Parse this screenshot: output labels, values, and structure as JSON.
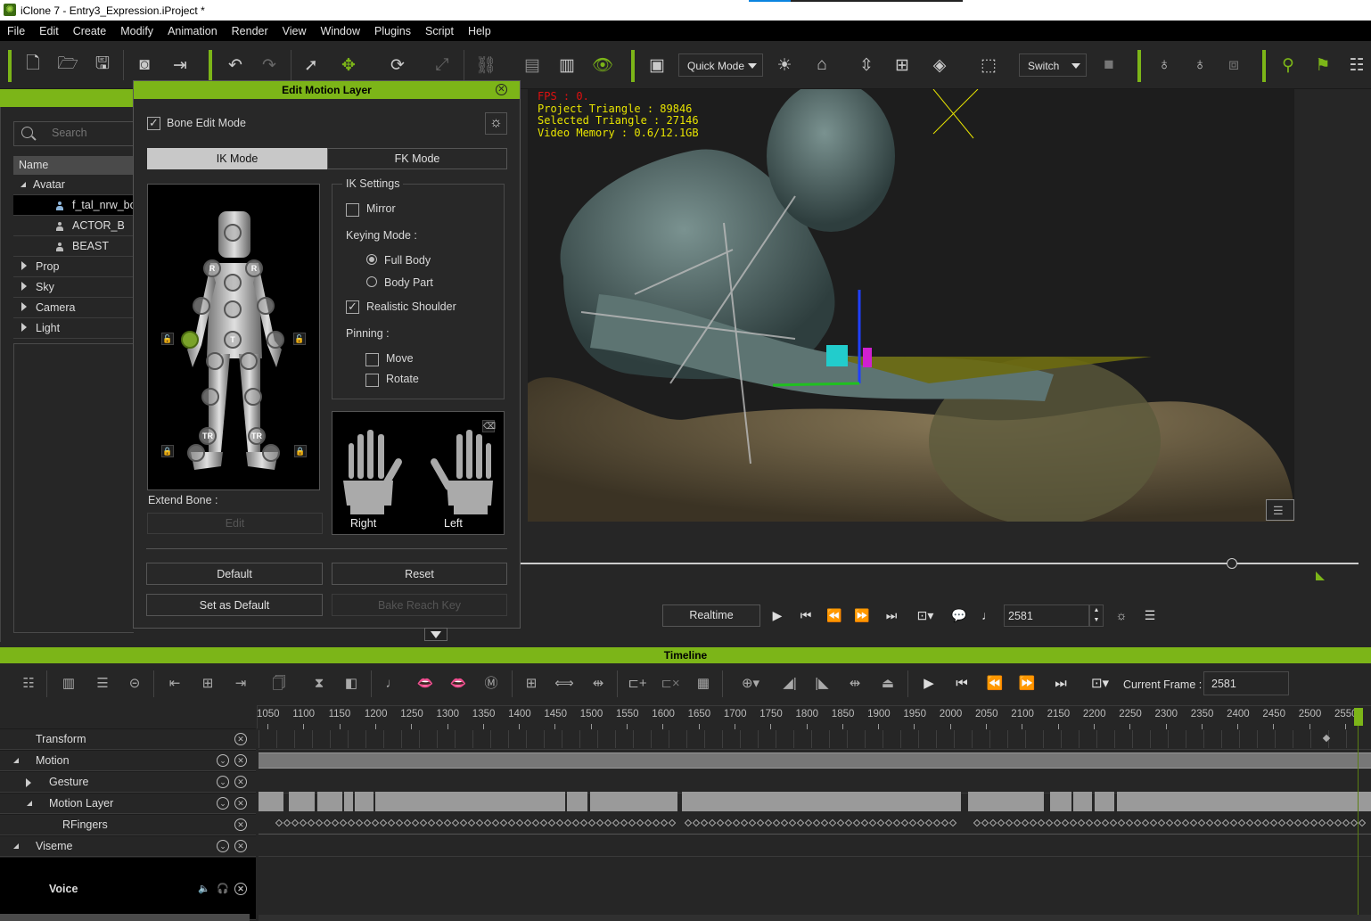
{
  "window": {
    "title": "iClone 7 - Entry3_Expression.iProject *"
  },
  "menu": [
    "File",
    "Edit",
    "Create",
    "Modify",
    "Animation",
    "Render",
    "View",
    "Window",
    "Plugins",
    "Script",
    "Help"
  ],
  "toolbar": {
    "mode_dropdown": "Quick Mode",
    "switch_dropdown": "Switch"
  },
  "scene_panel": {
    "search_placeholder": "Search",
    "column_header": "Name",
    "tree": [
      {
        "label": "Avatar",
        "expanded": true,
        "children": [
          {
            "label": "f_tal_nrw_bo",
            "selected": true
          },
          {
            "label": "ACTOR_B"
          },
          {
            "label": "BEAST"
          }
        ]
      },
      {
        "label": "Prop"
      },
      {
        "label": "Sky"
      },
      {
        "label": "Camera"
      },
      {
        "label": "Light"
      }
    ]
  },
  "dialog": {
    "title": "Edit Motion Layer",
    "bone_edit_mode": {
      "label": "Bone Edit Mode",
      "checked": true
    },
    "tabs": [
      {
        "label": "IK Mode",
        "active": true
      },
      {
        "label": "FK Mode",
        "active": false
      }
    ],
    "body_joint_labels": {
      "shoulder": "R",
      "hip": "T",
      "foot": "TR"
    },
    "ik_settings": {
      "group_label": "IK Settings",
      "mirror": {
        "label": "Mirror",
        "checked": false
      },
      "keying_mode_label": "Keying Mode :",
      "keying_options": [
        {
          "label": "Full Body",
          "selected": true
        },
        {
          "label": "Body Part",
          "selected": false
        }
      ],
      "realistic_shoulder": {
        "label": "Realistic Shoulder",
        "checked": true
      },
      "pinning_label": "Pinning :",
      "pin_move": {
        "label": "Move",
        "checked": false
      },
      "pin_rotate": {
        "label": "Rotate",
        "checked": false
      }
    },
    "hands": {
      "right": "Right",
      "left": "Left"
    },
    "extend_bone_label": "Extend Bone :",
    "edit_button": "Edit",
    "default_button": "Default",
    "reset_button": "Reset",
    "set_default_button": "Set as Default",
    "bake_button": "Bake Reach Key"
  },
  "viewport": {
    "fps": "FPS : 0.",
    "project_triangle": "Project Triangle : 89846",
    "selected_triangle": "Selected Triangle : 27146",
    "video_memory": "Video Memory : 0.6/12.1GB"
  },
  "playback": {
    "realtime_button": "Realtime",
    "frame_value": "2581"
  },
  "timeline": {
    "title": "Timeline",
    "current_frame_label": "Current Frame :",
    "current_frame_value": "2581",
    "ruler_ticks": [
      "1050",
      "1100",
      "1150",
      "1200",
      "1250",
      "1300",
      "1350",
      "1400",
      "1450",
      "1500",
      "1550",
      "1600",
      "1650",
      "1700",
      "1750",
      "1800",
      "1850",
      "1900",
      "1950",
      "2000",
      "2050",
      "2100",
      "2150",
      "2200",
      "2250",
      "2300",
      "2350",
      "2400",
      "2450",
      "2500",
      "2550"
    ],
    "tracks": [
      {
        "label": "Transform",
        "expander": "none",
        "indent": 0
      },
      {
        "label": "Motion",
        "expander": "expanded",
        "indent": 0
      },
      {
        "label": "Gesture",
        "expander": "collapsed",
        "indent": 1
      },
      {
        "label": "Motion Layer",
        "expander": "expanded",
        "indent": 1
      },
      {
        "label": "RFingers",
        "expander": "none",
        "indent": 2
      },
      {
        "label": "Viseme",
        "expander": "expanded",
        "indent": 0
      },
      {
        "label": "Voice",
        "expander": "none",
        "indent": 1
      }
    ]
  },
  "colors": {
    "accent": "#7cb518",
    "background": "#262626",
    "fps_text": "#e01010",
    "stats_text": "#e8e400"
  }
}
